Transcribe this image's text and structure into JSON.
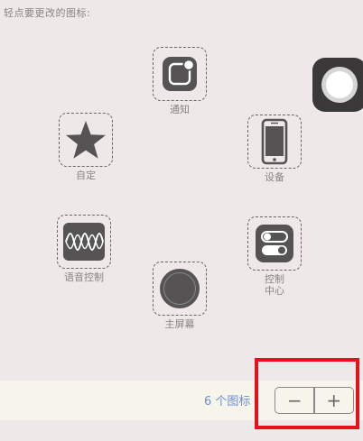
{
  "instruction": "轻点要更改的图标:",
  "menu_items": [
    {
      "id": "notification",
      "label": "通知",
      "icon": "notification-icon"
    },
    {
      "id": "device",
      "label": "设备",
      "icon": "phone-icon"
    },
    {
      "id": "control-center",
      "label": "控制\n中心",
      "icon": "toggle-switches-icon"
    },
    {
      "id": "home",
      "label": "主屏幕",
      "icon": "home-button-icon"
    },
    {
      "id": "voice-control",
      "label": "语音控制",
      "icon": "waveform-icon"
    },
    {
      "id": "custom",
      "label": "自定",
      "icon": "star-icon"
    }
  ],
  "assistive_touch": {
    "icon": "assistive-touch-icon"
  },
  "footer": {
    "count_label": "6 个图标",
    "decrement_label": "−",
    "increment_label": "+"
  },
  "colors": {
    "background": "#eee8e8",
    "icon_fill": "#555353",
    "label_text": "#8a8585",
    "count_text": "#6c8fd0",
    "highlight": "#e8101a"
  }
}
